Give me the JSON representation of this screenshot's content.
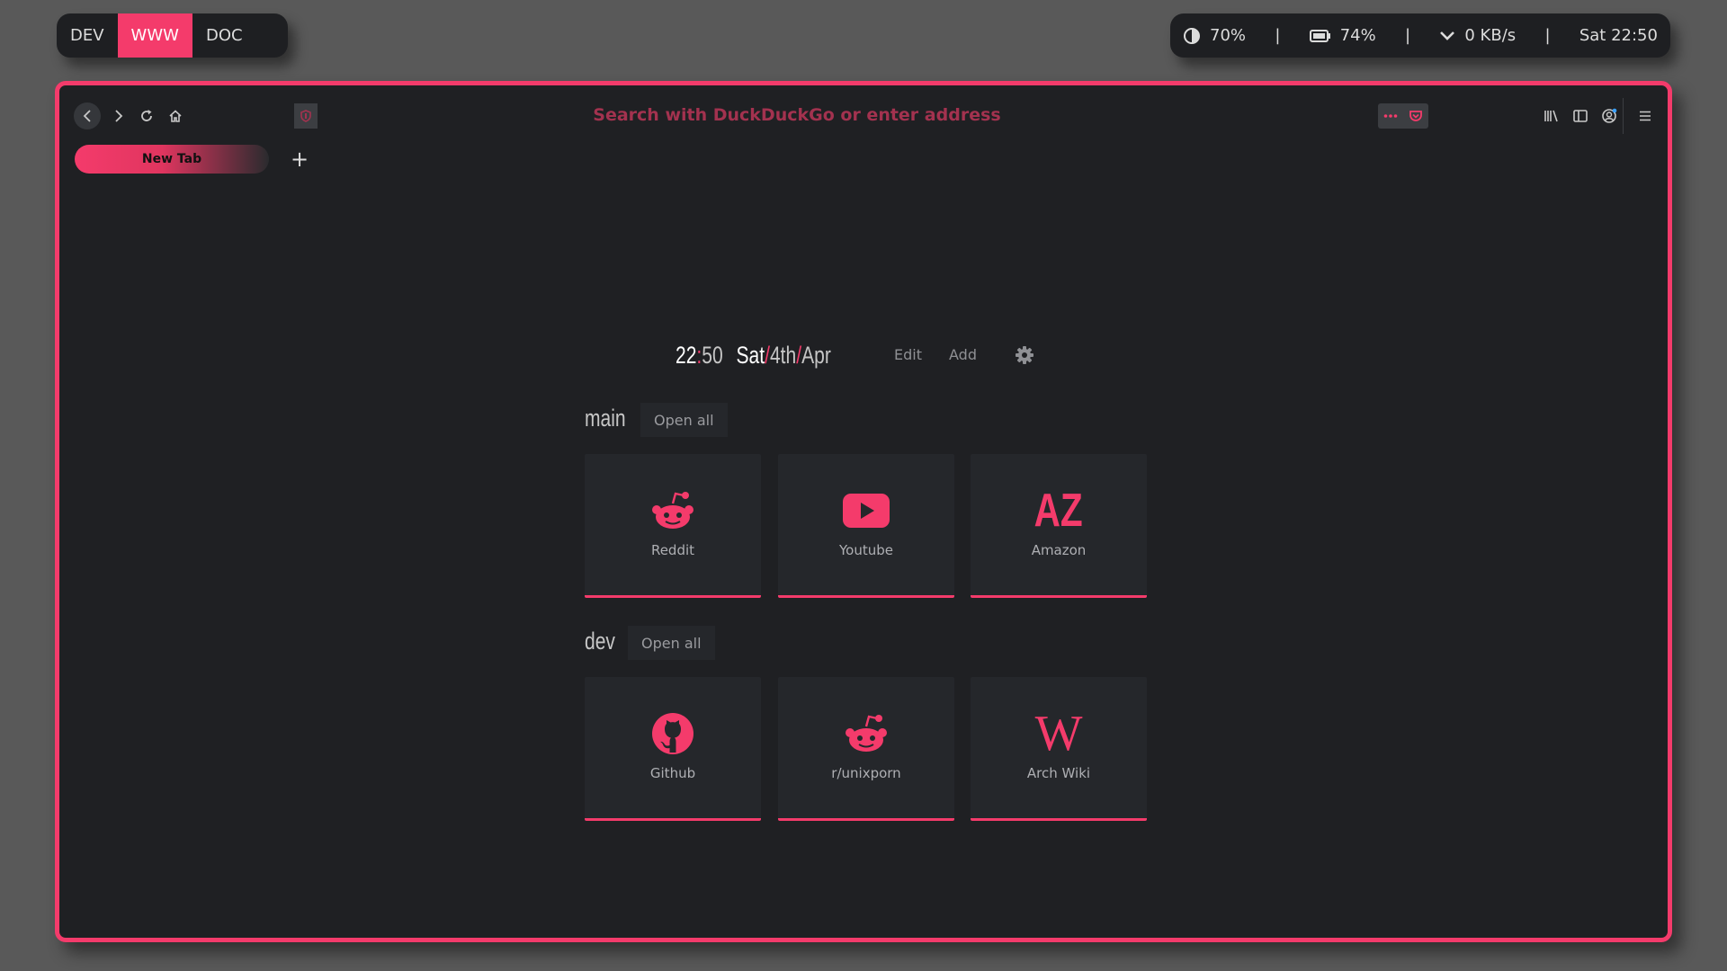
{
  "workspaces": [
    "DEV",
    "WWW",
    "DOC"
  ],
  "active_workspace": "WWW",
  "status": {
    "brightness": "70%",
    "battery": "74%",
    "network": "0 KB/s",
    "datetime": "Sat 22:50",
    "separator": "|"
  },
  "browser": {
    "url_placeholder": "Search with DuckDuckGo or enter address",
    "tab_title": "New Tab",
    "new_tab_symbol": "+"
  },
  "newtab": {
    "clock_hour": "22",
    "clock_sep": ":",
    "clock_min": "50",
    "day": "Sat",
    "date_sep": "/",
    "date": "4th",
    "month": "Apr",
    "edit_label": "Edit",
    "add_label": "Add",
    "groups": [
      {
        "title": "main",
        "open_all": "Open all",
        "links": [
          {
            "label": "Reddit",
            "icon": "reddit-icon"
          },
          {
            "label": "Youtube",
            "icon": "youtube-icon"
          },
          {
            "label": "Amazon",
            "icon": "amazon-icon",
            "glyph": "AZ"
          }
        ]
      },
      {
        "title": "dev",
        "open_all": "Open all",
        "links": [
          {
            "label": "Github",
            "icon": "github-icon"
          },
          {
            "label": "r/unixporn",
            "icon": "reddit-icon"
          },
          {
            "label": "Arch Wiki",
            "icon": "wikipedia-icon",
            "glyph": "W"
          }
        ]
      }
    ]
  },
  "colors": {
    "accent": "#f43b6b",
    "background": "#1f2023",
    "desktop": "#595959"
  }
}
